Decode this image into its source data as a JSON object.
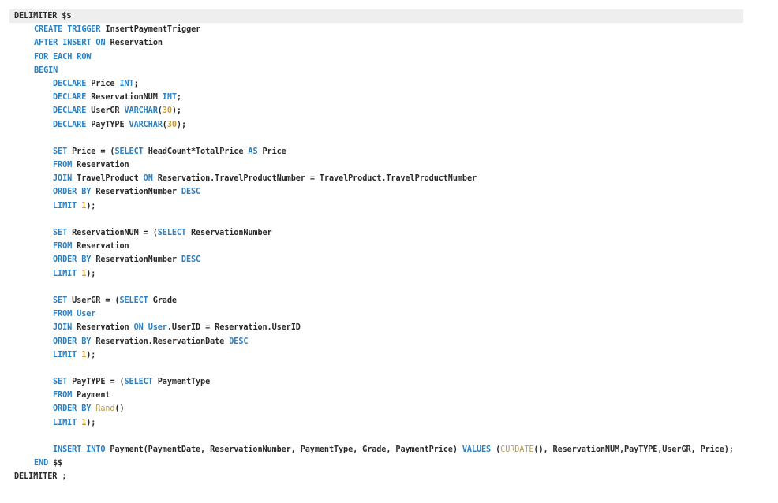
{
  "colors": {
    "keyword": "#2d7fbe",
    "number": "#c49a35",
    "function": "#b89b56",
    "text": "#2a2a2a",
    "current_line": "#eeeeee"
  },
  "code": [
    {
      "indent": 0,
      "current": true,
      "tokens": [
        {
          "t": "txt",
          "v": "DELIMITER $$"
        }
      ]
    },
    {
      "indent": 1,
      "tokens": [
        {
          "t": "kw",
          "v": "CREATE TRIGGER"
        },
        {
          "t": "txt",
          "v": " InsertPaymentTrigger"
        }
      ]
    },
    {
      "indent": 1,
      "tokens": [
        {
          "t": "kw",
          "v": "AFTER INSERT ON"
        },
        {
          "t": "txt",
          "v": " Reservation"
        }
      ]
    },
    {
      "indent": 1,
      "tokens": [
        {
          "t": "kw",
          "v": "FOR EACH ROW"
        }
      ]
    },
    {
      "indent": 1,
      "tokens": [
        {
          "t": "kw",
          "v": "BEGIN"
        }
      ]
    },
    {
      "indent": 2,
      "tokens": [
        {
          "t": "kw",
          "v": "DECLARE"
        },
        {
          "t": "txt",
          "v": " Price "
        },
        {
          "t": "kw",
          "v": "INT"
        },
        {
          "t": "txt",
          "v": ";"
        }
      ]
    },
    {
      "indent": 2,
      "tokens": [
        {
          "t": "kw",
          "v": "DECLARE"
        },
        {
          "t": "txt",
          "v": " ReservationNUM "
        },
        {
          "t": "kw",
          "v": "INT"
        },
        {
          "t": "txt",
          "v": ";"
        }
      ]
    },
    {
      "indent": 2,
      "tokens": [
        {
          "t": "kw",
          "v": "DECLARE"
        },
        {
          "t": "txt",
          "v": " UserGR "
        },
        {
          "t": "kw",
          "v": "VARCHAR"
        },
        {
          "t": "txt",
          "v": "("
        },
        {
          "t": "num",
          "v": "30"
        },
        {
          "t": "txt",
          "v": ");"
        }
      ]
    },
    {
      "indent": 2,
      "tokens": [
        {
          "t": "kw",
          "v": "DECLARE"
        },
        {
          "t": "txt",
          "v": " PayTYPE "
        },
        {
          "t": "kw",
          "v": "VARCHAR"
        },
        {
          "t": "txt",
          "v": "("
        },
        {
          "t": "num",
          "v": "30"
        },
        {
          "t": "txt",
          "v": ");"
        }
      ]
    },
    {
      "indent": 0,
      "tokens": []
    },
    {
      "indent": 2,
      "tokens": [
        {
          "t": "kw",
          "v": "SET"
        },
        {
          "t": "txt",
          "v": " Price = ("
        },
        {
          "t": "kw",
          "v": "SELECT"
        },
        {
          "t": "txt",
          "v": " HeadCount*TotalPrice "
        },
        {
          "t": "kw",
          "v": "AS"
        },
        {
          "t": "txt",
          "v": " Price"
        }
      ]
    },
    {
      "indent": 2,
      "tokens": [
        {
          "t": "kw",
          "v": "FROM"
        },
        {
          "t": "txt",
          "v": " Reservation"
        }
      ]
    },
    {
      "indent": 2,
      "tokens": [
        {
          "t": "kw",
          "v": "JOIN"
        },
        {
          "t": "txt",
          "v": " TravelProduct "
        },
        {
          "t": "kw",
          "v": "ON"
        },
        {
          "t": "txt",
          "v": " Reservation.TravelProductNumber = TravelProduct.TravelProductNumber"
        }
      ]
    },
    {
      "indent": 2,
      "tokens": [
        {
          "t": "kw",
          "v": "ORDER BY"
        },
        {
          "t": "txt",
          "v": " ReservationNumber "
        },
        {
          "t": "kw",
          "v": "DESC"
        }
      ]
    },
    {
      "indent": 2,
      "tokens": [
        {
          "t": "kw",
          "v": "LIMIT"
        },
        {
          "t": "txt",
          "v": " "
        },
        {
          "t": "num",
          "v": "1"
        },
        {
          "t": "txt",
          "v": ");"
        }
      ]
    },
    {
      "indent": 0,
      "tokens": []
    },
    {
      "indent": 2,
      "tokens": [
        {
          "t": "kw",
          "v": "SET"
        },
        {
          "t": "txt",
          "v": " ReservationNUM = ("
        },
        {
          "t": "kw",
          "v": "SELECT"
        },
        {
          "t": "txt",
          "v": " ReservationNumber"
        }
      ]
    },
    {
      "indent": 2,
      "tokens": [
        {
          "t": "kw",
          "v": "FROM"
        },
        {
          "t": "txt",
          "v": " Reservation"
        }
      ]
    },
    {
      "indent": 2,
      "tokens": [
        {
          "t": "kw",
          "v": "ORDER BY"
        },
        {
          "t": "txt",
          "v": " ReservationNumber "
        },
        {
          "t": "kw",
          "v": "DESC"
        }
      ]
    },
    {
      "indent": 2,
      "tokens": [
        {
          "t": "kw",
          "v": "LIMIT"
        },
        {
          "t": "txt",
          "v": " "
        },
        {
          "t": "num",
          "v": "1"
        },
        {
          "t": "txt",
          "v": ");"
        }
      ]
    },
    {
      "indent": 0,
      "tokens": []
    },
    {
      "indent": 2,
      "tokens": [
        {
          "t": "kw",
          "v": "SET"
        },
        {
          "t": "txt",
          "v": " UserGR = ("
        },
        {
          "t": "kw",
          "v": "SELECT"
        },
        {
          "t": "txt",
          "v": " Grade"
        }
      ]
    },
    {
      "indent": 2,
      "tokens": [
        {
          "t": "kw",
          "v": "FROM"
        },
        {
          "t": "txt",
          "v": " "
        },
        {
          "t": "kw",
          "v": "User"
        }
      ]
    },
    {
      "indent": 2,
      "tokens": [
        {
          "t": "kw",
          "v": "JOIN"
        },
        {
          "t": "txt",
          "v": " Reservation "
        },
        {
          "t": "kw",
          "v": "ON"
        },
        {
          "t": "txt",
          "v": " "
        },
        {
          "t": "kw",
          "v": "User"
        },
        {
          "t": "txt",
          "v": ".UserID = Reservation.UserID"
        }
      ]
    },
    {
      "indent": 2,
      "tokens": [
        {
          "t": "kw",
          "v": "ORDER BY"
        },
        {
          "t": "txt",
          "v": " Reservation.ReservationDate "
        },
        {
          "t": "kw",
          "v": "DESC"
        }
      ]
    },
    {
      "indent": 2,
      "tokens": [
        {
          "t": "kw",
          "v": "LIMIT"
        },
        {
          "t": "txt",
          "v": " "
        },
        {
          "t": "num",
          "v": "1"
        },
        {
          "t": "txt",
          "v": ");"
        }
      ]
    },
    {
      "indent": 0,
      "tokens": []
    },
    {
      "indent": 2,
      "tokens": [
        {
          "t": "kw",
          "v": "SET"
        },
        {
          "t": "txt",
          "v": " PayTYPE = ("
        },
        {
          "t": "kw",
          "v": "SELECT"
        },
        {
          "t": "txt",
          "v": " PaymentType"
        }
      ]
    },
    {
      "indent": 2,
      "tokens": [
        {
          "t": "kw",
          "v": "FROM"
        },
        {
          "t": "txt",
          "v": " Payment"
        }
      ]
    },
    {
      "indent": 2,
      "tokens": [
        {
          "t": "kw",
          "v": "ORDER BY"
        },
        {
          "t": "txt",
          "v": " "
        },
        {
          "t": "fn",
          "v": "Rand"
        },
        {
          "t": "txt",
          "v": "()"
        }
      ]
    },
    {
      "indent": 2,
      "tokens": [
        {
          "t": "kw",
          "v": "LIMIT"
        },
        {
          "t": "txt",
          "v": " "
        },
        {
          "t": "num",
          "v": "1"
        },
        {
          "t": "txt",
          "v": ");"
        }
      ]
    },
    {
      "indent": 0,
      "tokens": []
    },
    {
      "indent": 2,
      "tokens": [
        {
          "t": "kw",
          "v": "INSERT INTO"
        },
        {
          "t": "txt",
          "v": " Payment(PaymentDate, ReservationNumber, PaymentType, Grade, PaymentPrice) "
        },
        {
          "t": "kw",
          "v": "VALUES"
        },
        {
          "t": "txt",
          "v": " ("
        },
        {
          "t": "fn",
          "v": "CURDATE"
        },
        {
          "t": "txt",
          "v": "(), ReservationNUM,PayTYPE,UserGR, Price);"
        }
      ]
    },
    {
      "indent": 1,
      "tokens": [
        {
          "t": "kw",
          "v": "END"
        },
        {
          "t": "txt",
          "v": " $$"
        }
      ]
    },
    {
      "indent": 0,
      "tokens": [
        {
          "t": "txt",
          "v": "DELIMITER ;"
        }
      ]
    }
  ]
}
